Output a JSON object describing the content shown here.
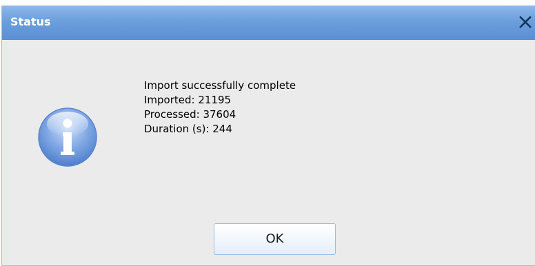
{
  "window": {
    "title": "Status",
    "close_icon": "close-icon"
  },
  "message": {
    "icon": "info-icon",
    "lines": [
      "Import successfully complete",
      "Imported: 21195",
      "Processed: 37604",
      "Duration (s): 244"
    ]
  },
  "buttons": {
    "ok_label": "OK"
  },
  "colors": {
    "titlebar": "#6b9fdc",
    "background": "#ebebeb",
    "button_border": "#9cbce2"
  }
}
